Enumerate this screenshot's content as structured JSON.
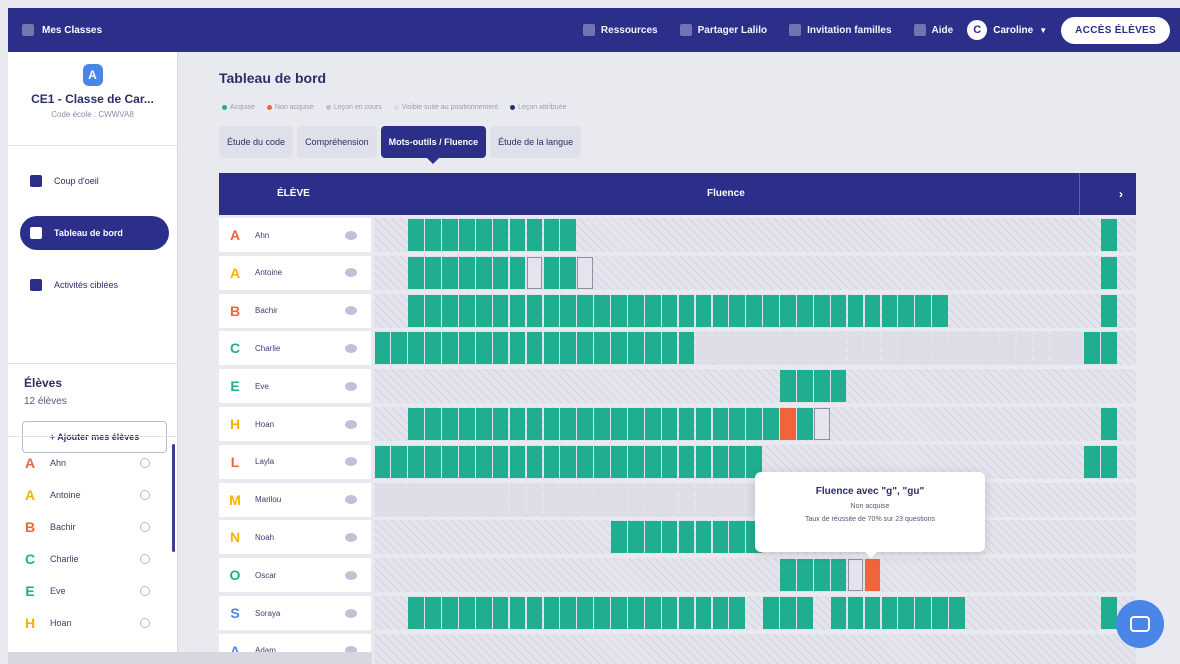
{
  "topbar": {
    "classes_label": "Mes Classes",
    "nav": [
      {
        "label": "Ressources",
        "icon": "book-icon"
      },
      {
        "label": "Partager Lalilo",
        "icon": "share-icon"
      },
      {
        "label": "Invitation familles",
        "icon": "family-icon"
      },
      {
        "label": "Aide",
        "icon": "help-icon"
      }
    ],
    "user_initial": "C",
    "user_name": "Caroline",
    "acces_label": "ACCÈS ÉLÈVES"
  },
  "sidebar": {
    "class_logo": "A",
    "class_name": "CE1 - Classe de Car...",
    "class_code": "Code école : CWWVA8",
    "menu": [
      {
        "label": "Coup d'oeil",
        "icon": "eye-overview-icon",
        "active": false
      },
      {
        "label": "Tableau de bord",
        "icon": "dashboard-icon",
        "active": true
      },
      {
        "label": "Activités ciblées",
        "icon": "activities-icon",
        "active": false
      }
    ],
    "eleves_title": "Élèves",
    "eleves_count": "12 élèves",
    "add_label": "+ Ajouter mes élèves",
    "students": [
      {
        "name": "Ahn",
        "letter": "A",
        "color": "#f0643c"
      },
      {
        "name": "Antoine",
        "letter": "A",
        "color": "#f5b400"
      },
      {
        "name": "Bachir",
        "letter": "B",
        "color": "#f0643c"
      },
      {
        "name": "Charlie",
        "letter": "C",
        "color": "#1fae8f"
      },
      {
        "name": "Eve",
        "letter": "E",
        "color": "#1fae8f"
      },
      {
        "name": "Hoan",
        "letter": "H",
        "color": "#f5b400"
      }
    ]
  },
  "main": {
    "title": "Tableau de bord",
    "legend": [
      {
        "label": "Acquise",
        "color": "#1fae8f"
      },
      {
        "label": "Non acquise",
        "color": "#f0643c"
      },
      {
        "label": "Leçon en cours",
        "color": "#bfc1d4"
      },
      {
        "label": "Visible suite au positionnement",
        "color": "#d9dae3"
      },
      {
        "label": "Leçon attribuée",
        "color": "#2b2f66"
      }
    ],
    "tabs": [
      {
        "label": "Étude du code",
        "active": false
      },
      {
        "label": "Compréhension",
        "active": false
      },
      {
        "label": "Mots-outils / Fluence",
        "active": true
      },
      {
        "label": "Étude de la langue",
        "active": false
      }
    ],
    "col_eleve": "ÉLÈVE",
    "col_fluence": "Fluence",
    "chevron": "›"
  },
  "grid": {
    "colors": {
      "acquired": "#1fae8f",
      "failed": "#f0643c",
      "current": "#e4e5ec",
      "plain": "#dcdde6"
    },
    "rows": [
      {
        "name": "Ahn",
        "letter": "A",
        "color": "#f0643c",
        "segments": [
          [
            "acq",
            2,
            10
          ],
          [
            "acq",
            43,
            1
          ]
        ]
      },
      {
        "name": "Antoine",
        "letter": "A",
        "color": "#f5b400",
        "segments": [
          [
            "acq",
            2,
            7
          ],
          [
            "cur",
            9,
            1
          ],
          [
            "acq",
            10,
            2
          ],
          [
            "cur",
            12,
            1
          ],
          [
            "acq",
            43,
            1
          ]
        ]
      },
      {
        "name": "Bachir",
        "letter": "B",
        "color": "#f0643c",
        "segments": [
          [
            "acq",
            2,
            21
          ],
          [
            "acq",
            23,
            11
          ],
          [
            "acq",
            43,
            1
          ]
        ]
      },
      {
        "name": "Charlie",
        "letter": "C",
        "color": "#1fae8f",
        "segments": [
          [
            "acq",
            0,
            19
          ],
          [
            "plain",
            19,
            23
          ],
          [
            "acq",
            42,
            2
          ]
        ]
      },
      {
        "name": "Eve",
        "letter": "E",
        "color": "#1fae8f",
        "segments": [
          [
            "acq",
            24,
            4
          ]
        ]
      },
      {
        "name": "Hoan",
        "letter": "H",
        "color": "#f5b400",
        "segments": [
          [
            "acq",
            2,
            22
          ],
          [
            "fail",
            24,
            1
          ],
          [
            "acq",
            25,
            1
          ],
          [
            "cur",
            26,
            1
          ],
          [
            "acq",
            43,
            1
          ]
        ]
      },
      {
        "name": "Layla",
        "letter": "L",
        "color": "#f0643c",
        "segments": [
          [
            "acq",
            0,
            23
          ],
          [
            "acq",
            42,
            2
          ]
        ]
      },
      {
        "name": "Marilou",
        "letter": "M",
        "color": "#f5b400",
        "segments": [
          [
            "plain",
            0,
            24
          ]
        ]
      },
      {
        "name": "Noah",
        "letter": "N",
        "color": "#f5b400",
        "segments": [
          [
            "acq",
            14,
            9
          ]
        ]
      },
      {
        "name": "Oscar",
        "letter": "O",
        "color": "#1fae8f",
        "segments": [
          [
            "acq",
            24,
            4
          ],
          [
            "cur",
            28,
            1
          ],
          [
            "fail",
            29,
            1
          ]
        ]
      },
      {
        "name": "Soraya",
        "letter": "S",
        "color": "#4a86e8",
        "segments": [
          [
            "acq",
            2,
            20
          ],
          [
            "acq",
            23,
            3
          ],
          [
            "acq",
            27,
            8
          ],
          [
            "acq",
            43,
            1
          ]
        ]
      },
      {
        "name": "Adam",
        "letter": "A",
        "color": "#4a86e8",
        "segments": []
      }
    ]
  },
  "tooltip": {
    "title": "Fluence avec \"g\", \"gu\"",
    "status": "Non acquise",
    "detail": "Taux de réussite de 70% sur 23 questions"
  }
}
